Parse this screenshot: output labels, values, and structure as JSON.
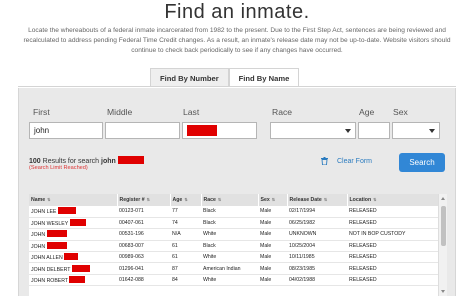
{
  "page": {
    "title": "Find an inmate.",
    "intro": "Locate the whereabouts of a federal inmate incarcerated from 1982 to the present. Due to the First Step Act, sentences are being reviewed and recalculated to address pending Federal Time Credit changes. As a result, an inmate's release date may not be up-to-date. Website visitors should continue to check back periodically to see if any changes have occurred."
  },
  "tabs": [
    {
      "label": "Find By Number",
      "active": false
    },
    {
      "label": "Find By Name",
      "active": true
    }
  ],
  "form": {
    "first_label": "First",
    "middle_label": "Middle",
    "last_label": "Last",
    "race_label": "Race",
    "age_label": "Age",
    "sex_label": "Sex",
    "first_value": "john",
    "middle_value": "",
    "race_value": "",
    "age_value": "",
    "sex_value": ""
  },
  "results": {
    "count": "100",
    "text": "Results for search",
    "query": "john",
    "limit_note": "(Search Limit Reached)"
  },
  "actions": {
    "clear_label": "Clear Form",
    "search_label": "Search"
  },
  "table": {
    "headers": [
      "Name",
      "Register #",
      "Age",
      "Race",
      "Sex",
      "Release Date",
      "Location"
    ],
    "rows": [
      {
        "name": "JOHN LEE",
        "register": "00123-071",
        "age": "77",
        "race": "Black",
        "sex": "Male",
        "release": "02/17/1994",
        "location": "RELEASED"
      },
      {
        "name": "JOHN WESLEY",
        "register": "00407-061",
        "age": "74",
        "race": "Black",
        "sex": "Male",
        "release": "06/25/1982",
        "location": "RELEASED"
      },
      {
        "name": "JOHN",
        "register": "00531-196",
        "age": "N/A",
        "race": "White",
        "sex": "Male",
        "release": "UNKNOWN",
        "location": "NOT IN BOP CUSTODY"
      },
      {
        "name": "JOHN",
        "register": "00683-007",
        "age": "61",
        "race": "Black",
        "sex": "Male",
        "release": "10/25/2004",
        "location": "RELEASED"
      },
      {
        "name": "JOHN ALLEN",
        "register": "00989-063",
        "age": "61",
        "race": "White",
        "sex": "Male",
        "release": "10/11/1985",
        "location": "RELEASED"
      },
      {
        "name": "JOHN DELBERT",
        "register": "01296-041",
        "age": "87",
        "race": "American Indian",
        "sex": "Male",
        "release": "08/23/1985",
        "location": "RELEASED"
      },
      {
        "name": "JOHN ROBERT",
        "register": "01642-088",
        "age": "84",
        "race": "White",
        "sex": "Male",
        "release": "04/02/1988",
        "location": "RELEASED"
      }
    ]
  },
  "colors": {
    "accent": "#3187d6",
    "redaction": "#e00000",
    "panel": "#e9e9e9"
  }
}
